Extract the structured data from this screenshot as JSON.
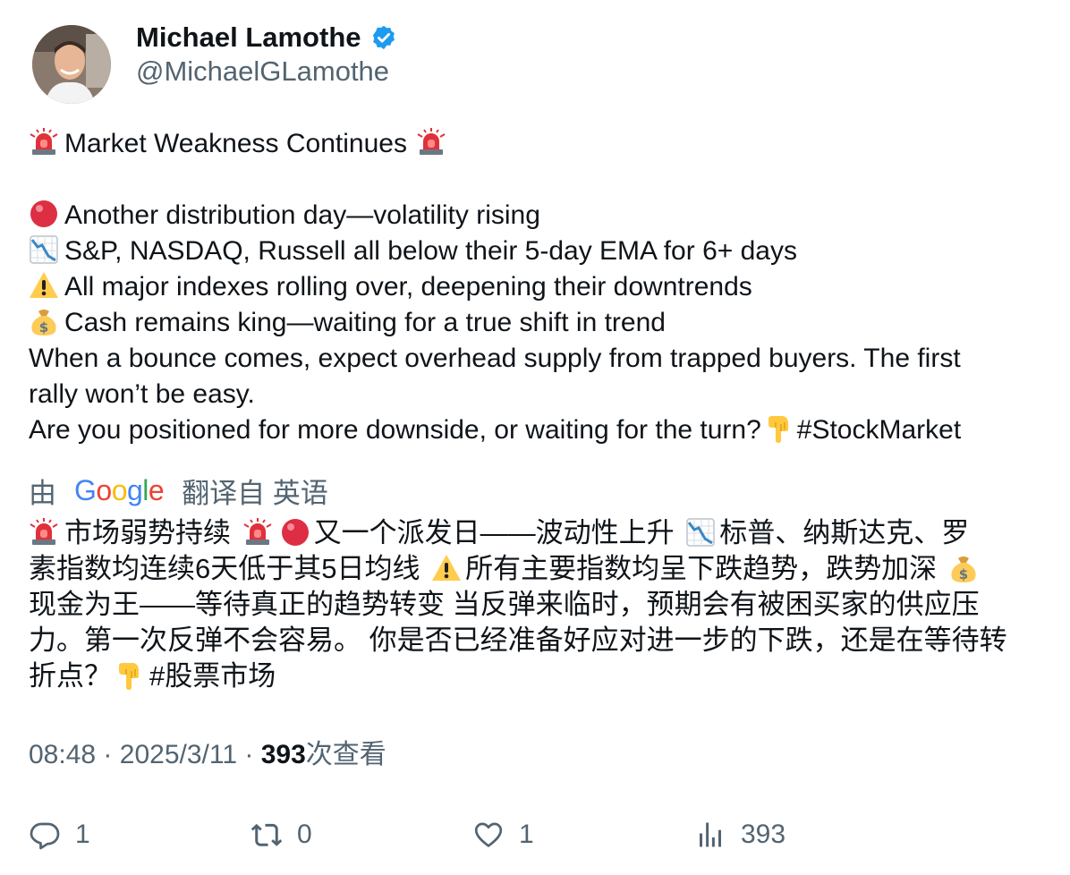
{
  "author": {
    "display_name": "Michael Lamothe",
    "handle": "@MichaelGLamothe",
    "verified": true,
    "verified_color": "#1d9bf0"
  },
  "tweet": {
    "title_line": "Market Weakness Continues",
    "bullets": [
      {
        "icon": "red-circle-icon",
        "text": "Another distribution day—volatility rising"
      },
      {
        "icon": "chart-decreasing-icon",
        "text": "S&P, NASDAQ, Russell all below their 5-day EMA for 6+ days"
      },
      {
        "icon": "warning-icon",
        "text": "All major indexes rolling over, deepening their downtrends"
      },
      {
        "icon": "money-bag-icon",
        "text": "Cash remains king—waiting for a true shift in trend"
      }
    ],
    "paragraph_1a": "When a bounce comes, expect overhead supply from trapped buyers. The first",
    "paragraph_1b": "rally won’t be easy.",
    "paragraph_2": "Are you positioned for more downside, or waiting for the turn?",
    "hashtag": "#StockMarket"
  },
  "translation": {
    "prefix": "由",
    "provider": "Google",
    "suffix": "翻译自 英语",
    "line_1_a": "市场弱势持续",
    "line_1_b": "又一个派发日——波动性上升",
    "line_1_c": "标普、纳斯达克、罗",
    "line_2_a": "素指数均连续6天低于其5日均线",
    "line_2_b": "所有主要指数均呈下跌趋势，跌势加深",
    "line_3": "现金为王——等待真正的趋势转变 当反弹来临时，预期会有被困买家的供应压",
    "line_4": "力。第一次反弹不会容易。 你是否已经准备好应对进一步的下跌，还是在等待转",
    "line_5_a": "折点？",
    "line_5_b": "#股票市场"
  },
  "meta": {
    "time": "08:48",
    "date": "2025/3/11",
    "separator": "·",
    "views_count": "393",
    "views_label": "次查看"
  },
  "actions": {
    "replies": "1",
    "reposts": "0",
    "likes": "1",
    "views": "393"
  }
}
